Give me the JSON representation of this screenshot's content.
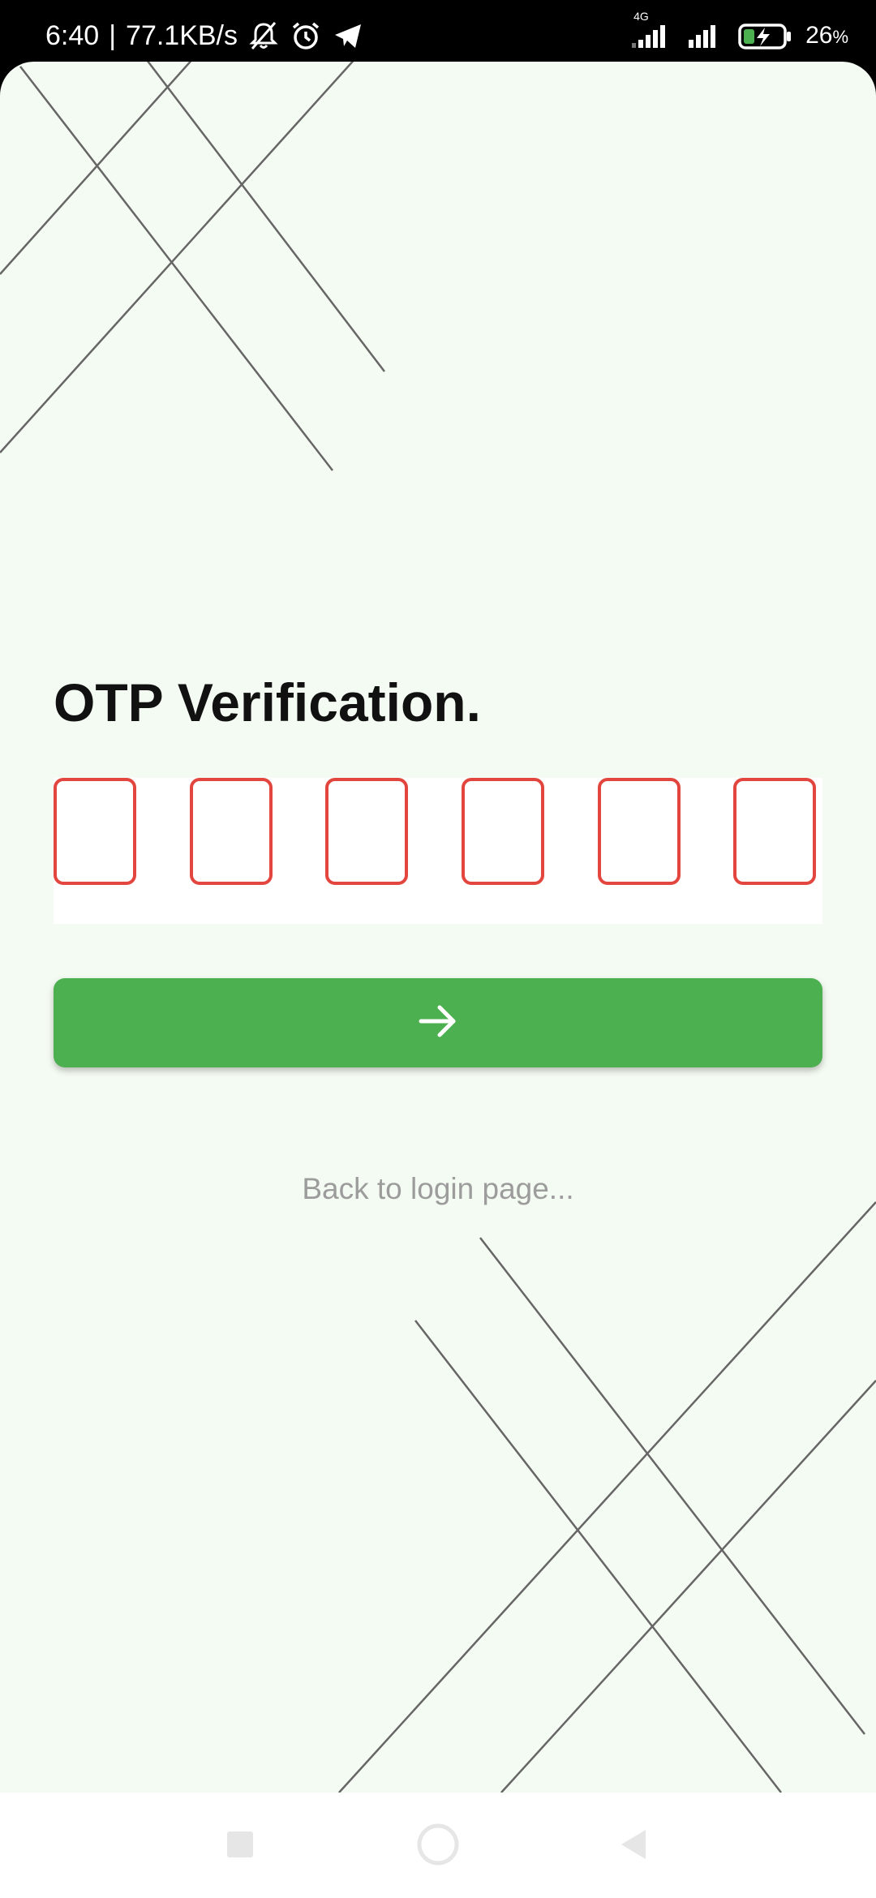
{
  "status_bar": {
    "time": "6:40",
    "separator": "|",
    "network_speed": "77.1KB/s",
    "network_type": "4G",
    "battery_percent": "26",
    "battery_unit": "%",
    "icons": [
      "muted-bell-icon",
      "alarm-icon",
      "telegram-icon",
      "signal-4g-icon",
      "signal-icon",
      "battery-charging-icon"
    ]
  },
  "screen": {
    "title": "OTP Verification.",
    "otp": {
      "length": 6,
      "values": [
        "",
        "",
        "",
        "",
        "",
        ""
      ],
      "box_border_color": "#e2463f"
    },
    "submit_button": {
      "icon": "arrow-right-icon",
      "color": "#4caf50"
    },
    "back_link": "Back to login page..."
  },
  "colors": {
    "background": "#f4fbf2",
    "line": "#666666",
    "link_text": "#9c9c9c"
  },
  "nav_bar": {
    "buttons": [
      "recents-square-icon",
      "home-circle-icon",
      "back-triangle-icon"
    ]
  }
}
